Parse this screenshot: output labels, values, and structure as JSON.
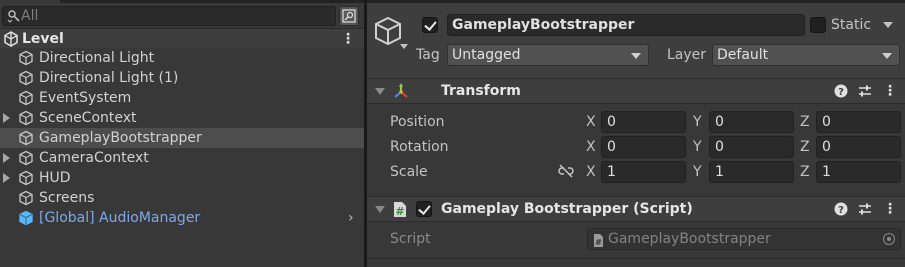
{
  "hierarchy": {
    "search": {
      "placeholder": "All"
    },
    "scene": {
      "name": "Level"
    },
    "items": [
      {
        "label": "Directional Light",
        "expandable": false,
        "selected": false,
        "prefab": false
      },
      {
        "label": "Directional Light (1)",
        "expandable": false,
        "selected": false,
        "prefab": false
      },
      {
        "label": "EventSystem",
        "expandable": false,
        "selected": false,
        "prefab": false
      },
      {
        "label": "SceneContext",
        "expandable": true,
        "selected": false,
        "prefab": false
      },
      {
        "label": "GameplayBootstrapper",
        "expandable": false,
        "selected": true,
        "prefab": false
      },
      {
        "label": "CameraContext",
        "expandable": true,
        "selected": false,
        "prefab": false
      },
      {
        "label": "HUD",
        "expandable": true,
        "selected": false,
        "prefab": false
      },
      {
        "label": "Screens",
        "expandable": false,
        "selected": false,
        "prefab": false
      },
      {
        "label": "[Global] AudioManager",
        "expandable": false,
        "selected": false,
        "prefab": true
      }
    ]
  },
  "inspector": {
    "gameobject": {
      "active": true,
      "name": "GameplayBootstrapper",
      "static_label": "Static",
      "static": false,
      "tag_label": "Tag",
      "tag_value": "Untagged",
      "layer_label": "Layer",
      "layer_value": "Default"
    },
    "transform": {
      "title": "Transform",
      "position_label": "Position",
      "rotation_label": "Rotation",
      "scale_label": "Scale",
      "x_label": "X",
      "y_label": "Y",
      "z_label": "Z",
      "position": {
        "x": "0",
        "y": "0",
        "z": "0"
      },
      "rotation": {
        "x": "0",
        "y": "0",
        "z": "0"
      },
      "scale": {
        "x": "1",
        "y": "1",
        "z": "1"
      }
    },
    "script_component": {
      "enabled": true,
      "title": "Gameplay Bootstrapper (Script)",
      "script_label": "Script",
      "script_value": "GameplayBootstrapper"
    }
  },
  "colors": {
    "panel_bg": "#383838",
    "header_bg": "#3e3e3e",
    "selected_row": "#4d4d4d",
    "prefab_text": "#7fa8e8",
    "prefab_icon": "#5cb7f5"
  }
}
